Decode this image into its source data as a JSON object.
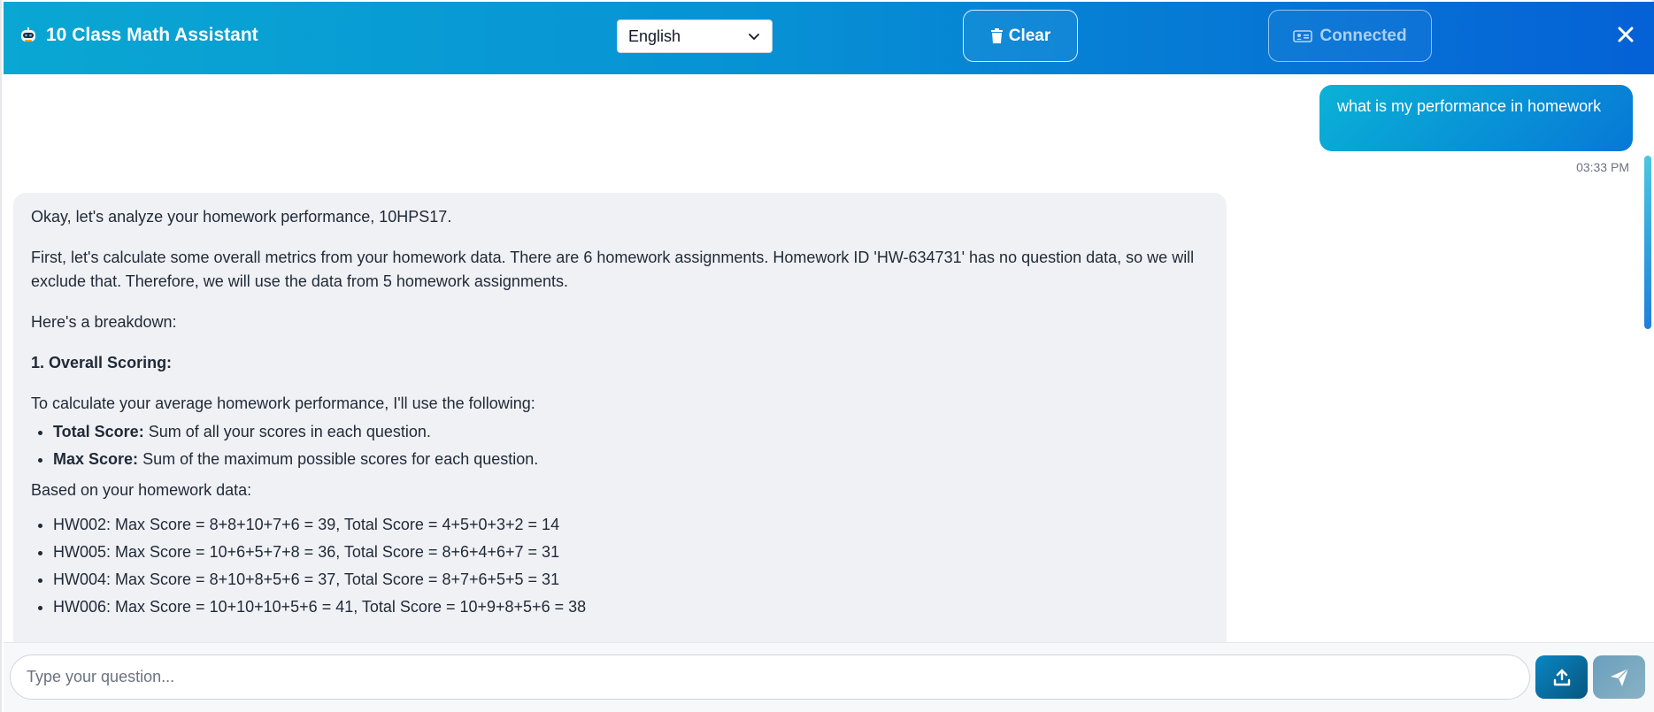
{
  "header": {
    "title": "10 Class Math Assistant",
    "language_selected": "English",
    "clear_label": "Clear",
    "connected_label": "Connected",
    "icons": {
      "brand": "robot-icon",
      "language": "chevron-down-icon",
      "clear": "trash-icon",
      "connected": "id-card-icon",
      "close": "close-icon"
    }
  },
  "chat": {
    "user_message": {
      "text": "what is my performance in homework",
      "time": "03:33 PM"
    },
    "assistant_message": {
      "intro": "Okay, let's analyze your homework performance, 10HPS17.",
      "paragraph1": "First, let's calculate some overall metrics from your homework data. There are 6 homework assignments. Homework ID 'HW-634731' has no question data, so we will exclude that. Therefore, we will use the data from 5 homework assignments.",
      "paragraph2": "Here's a breakdown:",
      "section1_title": "1. Overall Scoring:",
      "paragraph3": "To calculate your average homework performance, I'll use the following:",
      "definitions": [
        {
          "term": "Total Score:",
          "desc": "Sum of all your scores in each question."
        },
        {
          "term": "Max Score:",
          "desc": "Sum of the maximum possible scores for each question."
        }
      ],
      "paragraph4": "Based on your homework data:",
      "homework_rows": [
        "HW002: Max Score = 8+8+10+7+6 = 39, Total Score = 4+5+0+3+2 = 14",
        "HW005: Max Score = 10+6+5+7+8 = 36, Total Score = 8+6+4+6+7 = 31",
        "HW004: Max Score = 8+10+8+5+6 = 37, Total Score = 8+7+6+5+5 = 31",
        "HW006: Max Score = 10+10+10+5+6 = 41, Total Score = 10+9+8+5+6 = 38"
      ]
    }
  },
  "composer": {
    "placeholder": "Type your question...",
    "upload_icon": "upload-icon",
    "send_icon": "send-icon"
  },
  "colors": {
    "header_start": "#0aa7d3",
    "header_end": "#0561d6",
    "assistant_bg": "#f0f1f5",
    "user_bubble_start": "#0ab2d6",
    "user_bubble_end": "#0778d6"
  }
}
